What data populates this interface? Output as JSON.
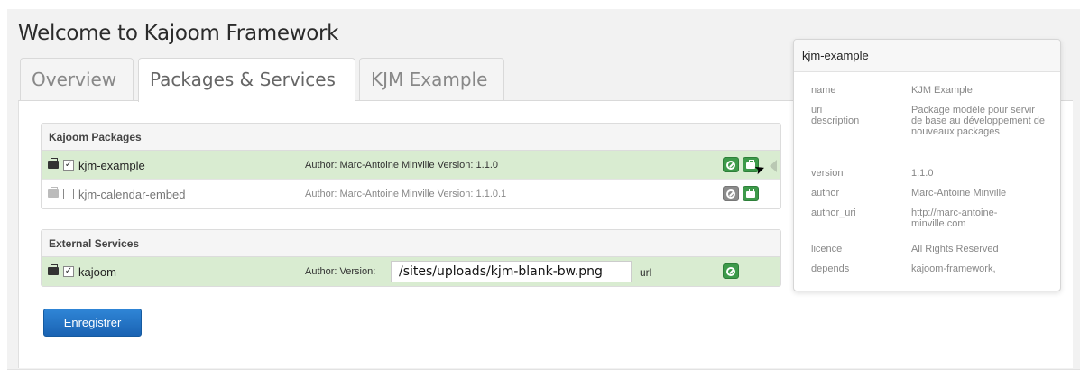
{
  "page": {
    "title": "Welcome to Kajoom Framework"
  },
  "tabs": [
    {
      "label": "Overview",
      "active": false
    },
    {
      "label": "Packages & Services",
      "active": true
    },
    {
      "label": "KJM Example",
      "active": false
    }
  ],
  "packages": {
    "heading": "Kajoom Packages",
    "rows": [
      {
        "name": "kjm-example",
        "checked": true,
        "author": "Author: Marc-Antoine Minville Version: 1.1.0",
        "active": true
      },
      {
        "name": "kjm-calendar-embed",
        "checked": false,
        "author": "Author: Marc-Antoine Minville Version: 1.1.0.1",
        "active": false
      }
    ]
  },
  "services": {
    "heading": "External Services",
    "rows": [
      {
        "name": "kajoom",
        "checked": true,
        "author": "Author: Version:",
        "url_value": "/sites/uploads/kjm-blank-bw.png",
        "url_suffix": "url"
      }
    ]
  },
  "save_button": {
    "label": "Enregistrer"
  },
  "popover": {
    "title": "kjm-example",
    "properties": [
      {
        "key": "name",
        "value": "KJM Example"
      },
      {
        "key": "uri\ndescription",
        "value": "Package modèle pour servir de base au développement de nouveaux packages"
      },
      {
        "key": "version",
        "value": "1.1.0"
      },
      {
        "key": "author",
        "value": "Marc-Antoine Minville"
      },
      {
        "key": "author_uri",
        "value": "http://marc-antoine-minville.com"
      },
      {
        "key": "licence",
        "value": "All Rights Reserved"
      },
      {
        "key": "depends",
        "value": "kajoom-framework,"
      }
    ]
  },
  "colors": {
    "active_row": "#d9ecd1",
    "green_button": "#3d9a4a",
    "primary_button": "#1a63b3"
  },
  "icons": [
    "package-icon",
    "checkbox-icon",
    "ban-icon",
    "briefcase-icon",
    "mouse-cursor-icon",
    "pointer-arrow-icon"
  ]
}
